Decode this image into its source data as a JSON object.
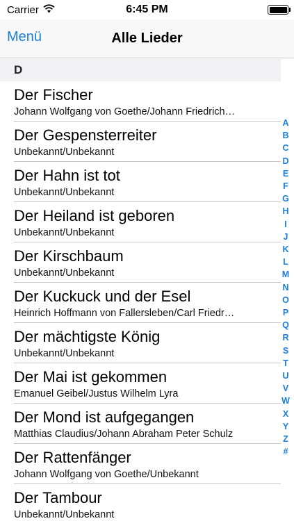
{
  "status_bar": {
    "carrier": "Carrier",
    "time": "6:45 PM"
  },
  "nav": {
    "back_label": "Menü",
    "title": "Alle Lieder"
  },
  "section": {
    "letter": "D"
  },
  "songs": [
    {
      "title": "Der Fischer",
      "subtitle": "Johann Wolfgang von Goethe/Johann Friedrich…"
    },
    {
      "title": "Der Gespensterreiter",
      "subtitle": "Unbekannt/Unbekannt"
    },
    {
      "title": "Der Hahn ist tot",
      "subtitle": "Unbekannt/Unbekannt"
    },
    {
      "title": "Der Heiland ist geboren",
      "subtitle": "Unbekannt/Unbekannt"
    },
    {
      "title": "Der Kirschbaum",
      "subtitle": "Unbekannt/Unbekannt"
    },
    {
      "title": "Der Kuckuck und der Esel",
      "subtitle": "Heinrich Hoffmann von Fallersleben/Carl Friedr…"
    },
    {
      "title": "Der mächtigste König",
      "subtitle": "Unbekannt/Unbekannt"
    },
    {
      "title": "Der Mai ist gekommen",
      "subtitle": "Emanuel Geibel/Justus Wilhelm Lyra"
    },
    {
      "title": "Der Mond ist aufgegangen",
      "subtitle": "Matthias Claudius/Johann Abraham Peter Schulz"
    },
    {
      "title": "Der Rattenfänger",
      "subtitle": "Johann Wolfgang von Goethe/Unbekannt"
    },
    {
      "title": "Der Tambour",
      "subtitle": "Unbekannt/Unbekannt"
    }
  ],
  "index_letters": [
    "A",
    "B",
    "C",
    "D",
    "E",
    "F",
    "G",
    "H",
    "I",
    "J",
    "K",
    "L",
    "M",
    "N",
    "O",
    "P",
    "Q",
    "R",
    "S",
    "T",
    "U",
    "V",
    "W",
    "X",
    "Y",
    "Z",
    "#"
  ],
  "colors": {
    "accent": "#1a7ddb",
    "separator": "#c8c7cc",
    "section_bg": "#f2f2f5"
  }
}
